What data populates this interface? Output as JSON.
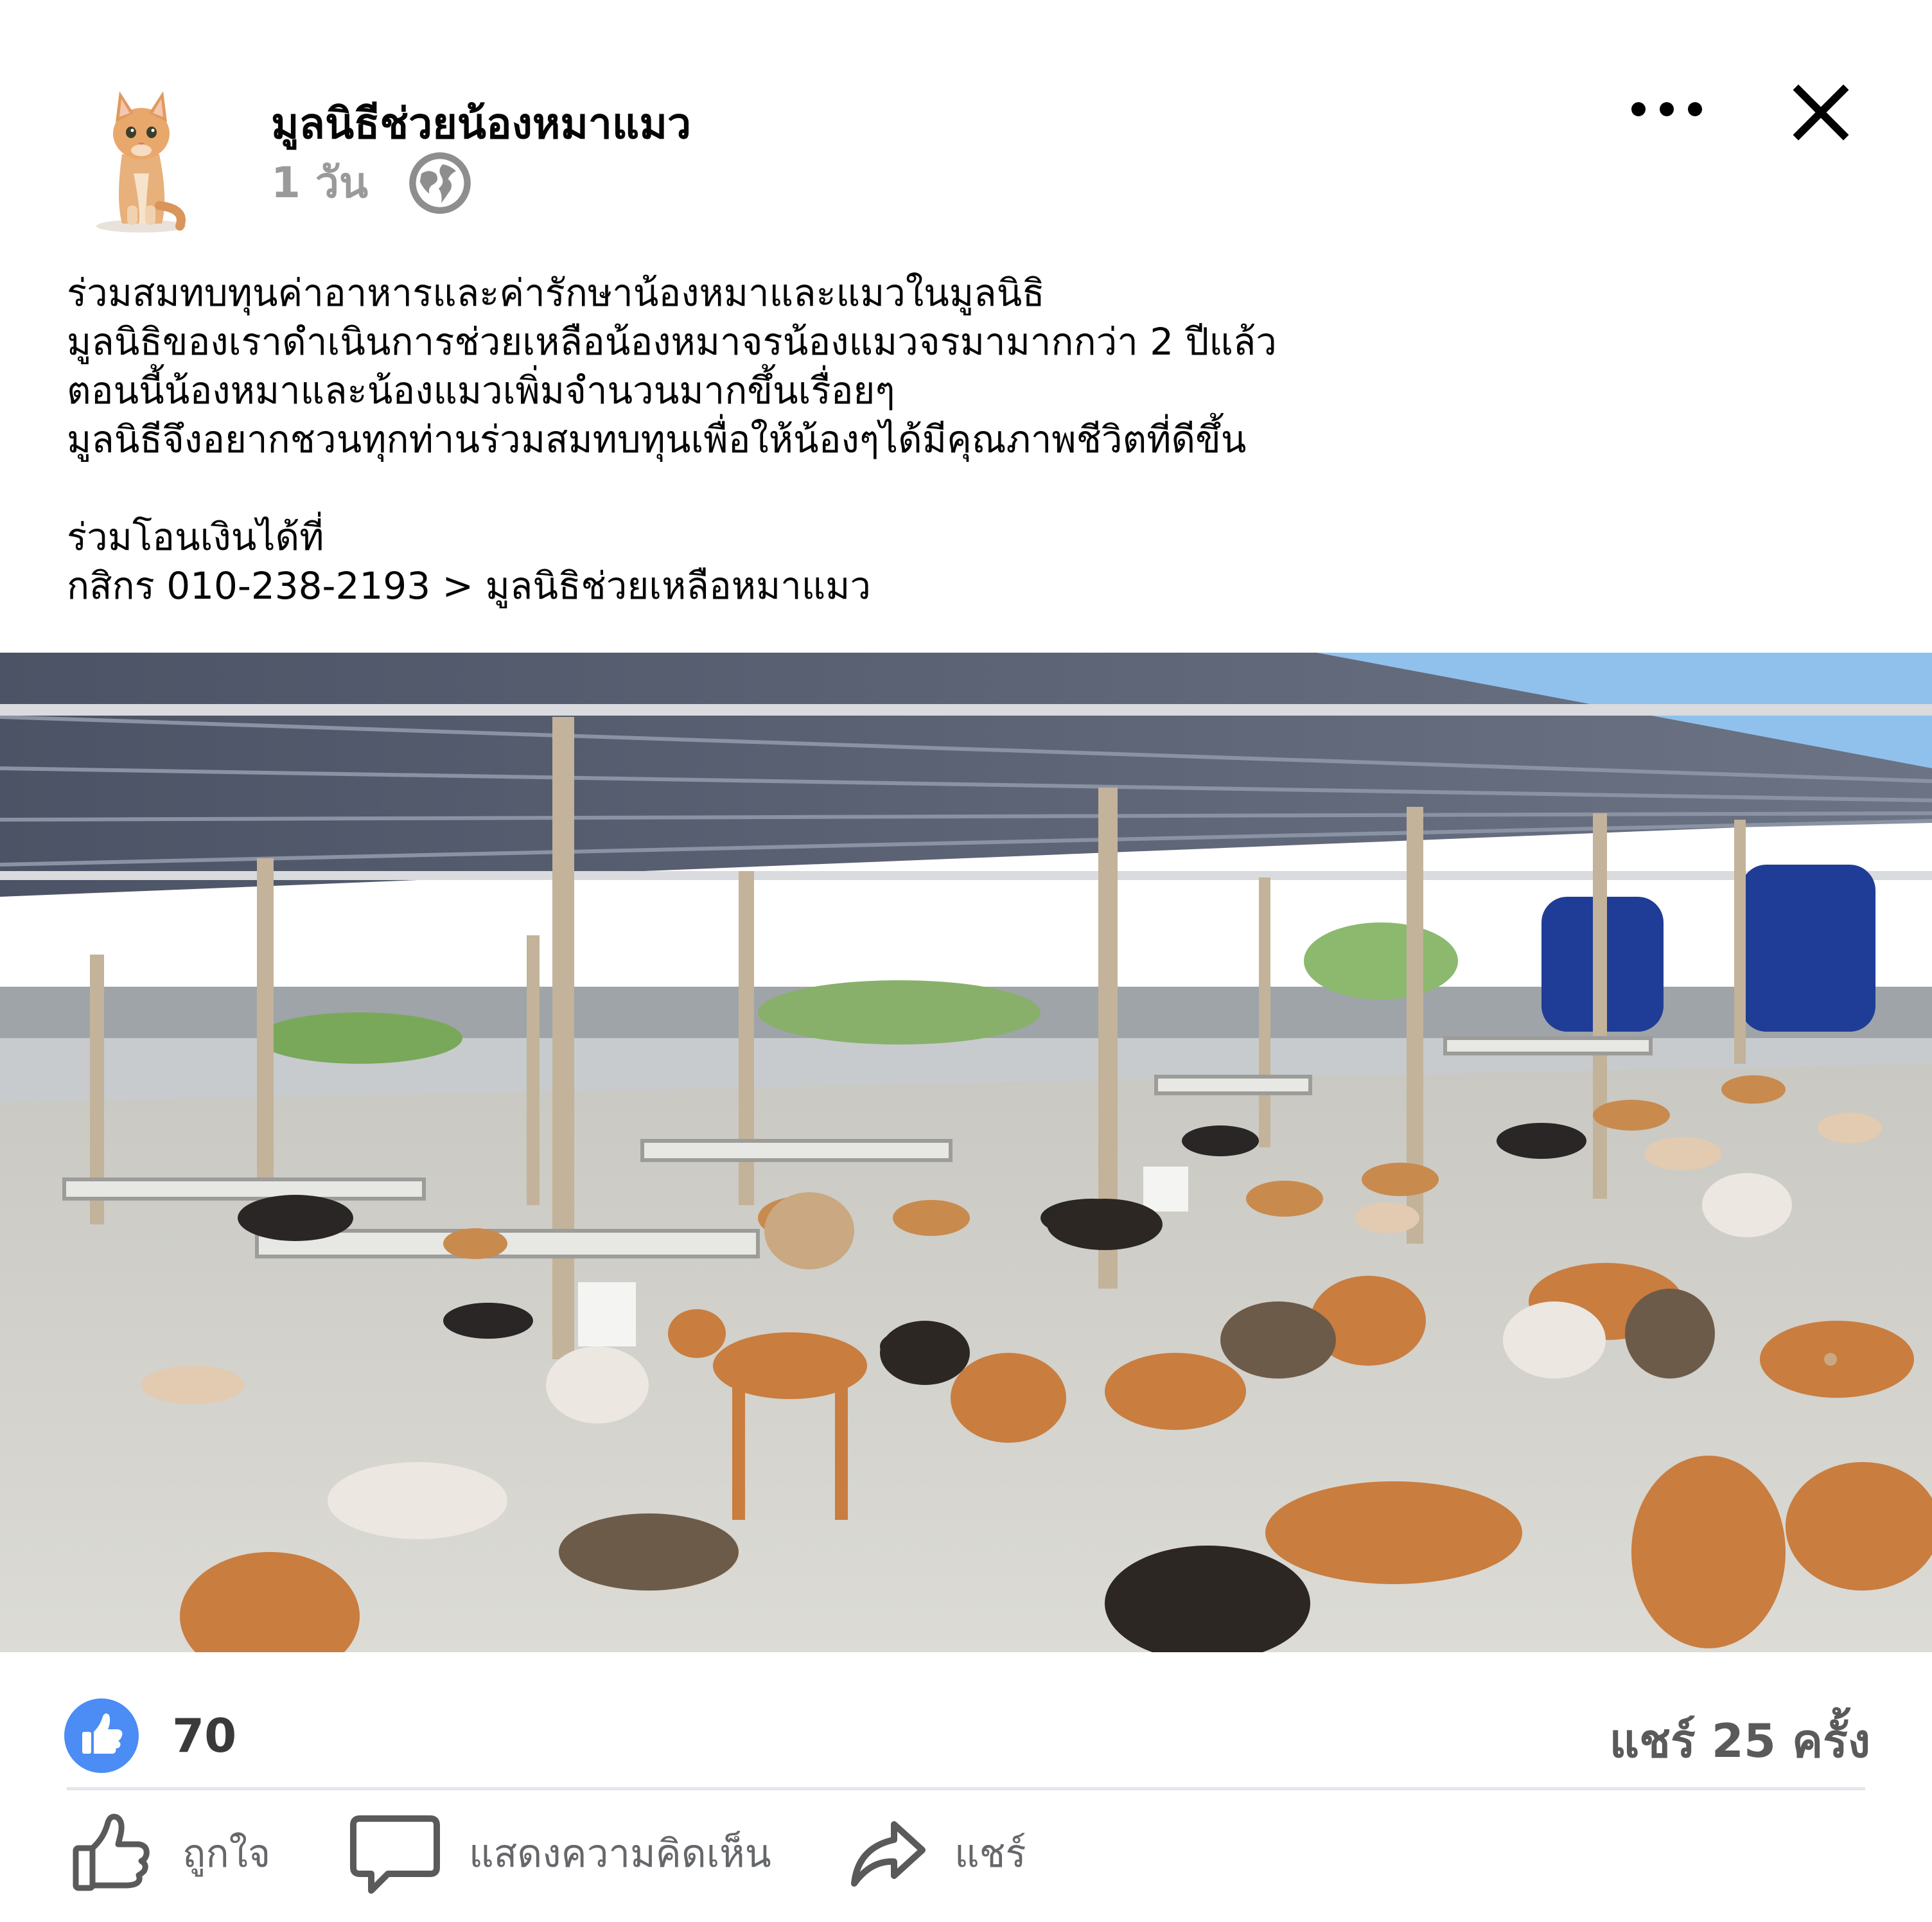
{
  "header": {
    "page_name": "มูลนิธีช่วยน้องหมาแมว",
    "post_time": "1 วัน",
    "privacy_icon": "globe-icon",
    "more_icon": "ellipsis-icon",
    "close_icon": "close-icon"
  },
  "post": {
    "lines": [
      "ร่วมสมทบทุนค่าอาหารและค่ารักษาน้องหมาและแมวในมูลนิธิ",
      "มูลนิธิของเราดำเนินการช่วยเหลือน้องหมาจรน้องแมวจรมามากกว่า 2 ปีแล้ว",
      "ตอนนี้น้องหมาและน้องแมวเพิ่มจำนวนมากขึ้นเรื่อยๆ",
      "มูลนิธีจึงอยากชวนทุกท่านร่วมสมทบทุนเพื่อให้น้องๆได้มีคุณภาพชีวิตที่ดีขึ้น",
      "",
      "ร่วมโอนเงินได้ที่",
      "กสิกร 010-238-2193 > มูลนิธิช่วยเหลือหมาแมว"
    ]
  },
  "stats": {
    "like_count": "70",
    "share_count": "แชร์ 25 ครั้ง"
  },
  "actions": {
    "like_label": "ถูกใจ",
    "comment_label": "แสดงความคิดเห็น",
    "share_label": "แชร์"
  },
  "colors": {
    "accent_blue": "#4b8cf5",
    "text": "#050505",
    "muted": "#65676b"
  }
}
